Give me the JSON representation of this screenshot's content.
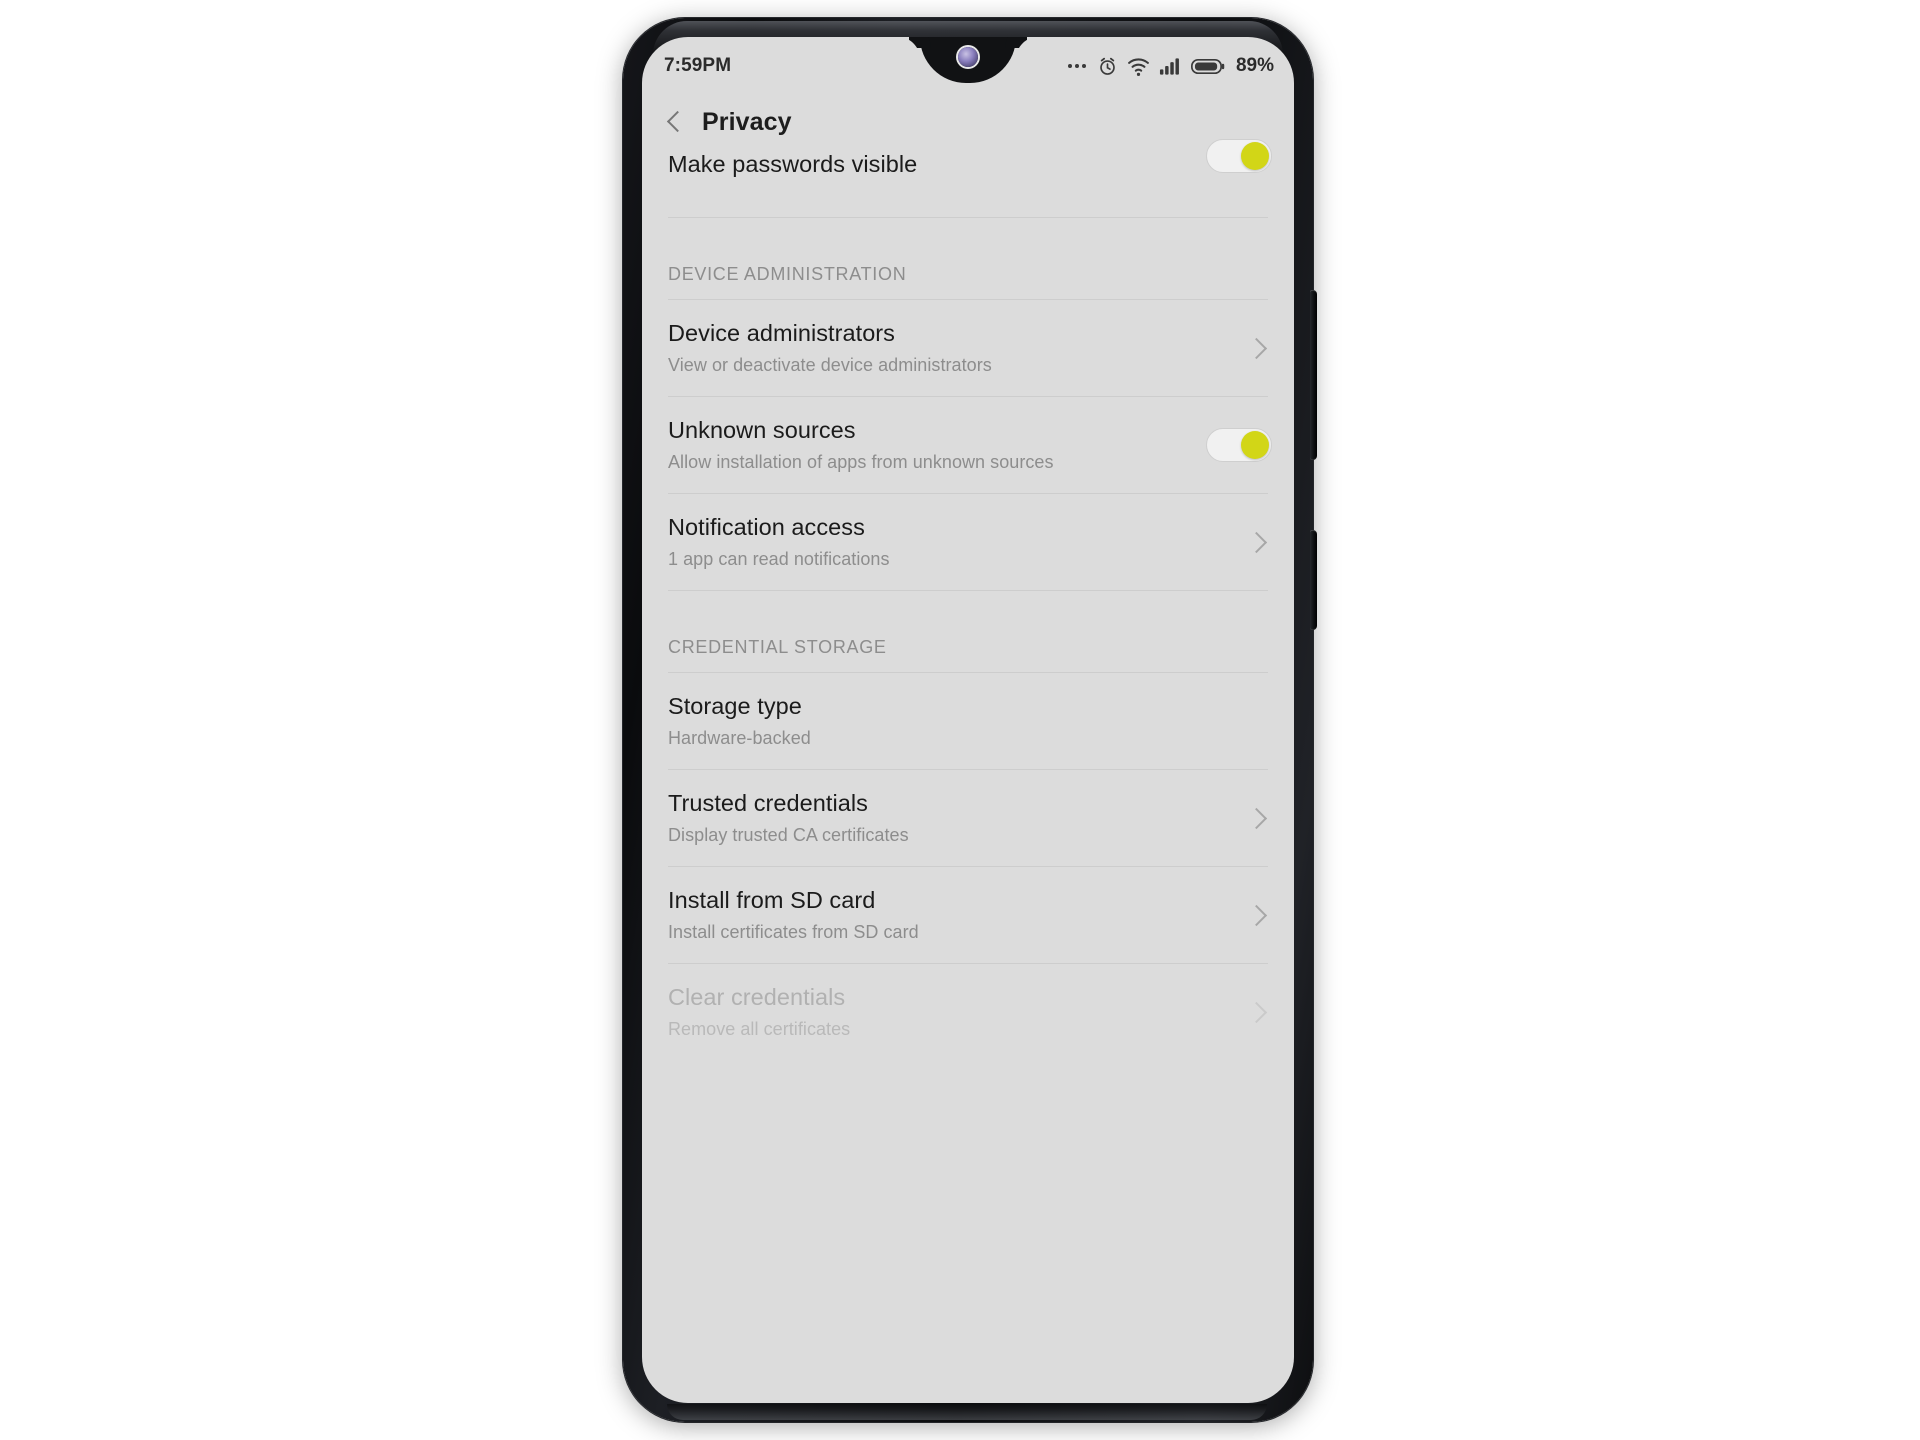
{
  "status_bar": {
    "time": "7:59PM",
    "battery_percent": "89%",
    "icons": [
      "more-dots-icon",
      "alarm-clock-icon",
      "wifi-icon",
      "signal-bars-icon",
      "battery-icon"
    ]
  },
  "app_bar": {
    "back_label": "back-chevron",
    "title": "Privacy"
  },
  "colors": {
    "screen_background": "#dcdcdc",
    "toggle_on_knob": "#d2d617",
    "toggle_track": "#f1f1f1",
    "title_text": "#1b1b1b",
    "subtitle_text": "#8d8d8d",
    "disabled_text": "#b1b1b1",
    "divider": "#cdcdcd"
  },
  "list": {
    "partial_top_row": {
      "title": "Make passwords visible",
      "control": "toggle",
      "toggle_on": true
    },
    "sections": [
      {
        "header": "DEVICE ADMINISTRATION",
        "rows": [
          {
            "title": "Device administrators",
            "subtitle": "View or deactivate device administrators",
            "control": "chevron",
            "disabled": false
          },
          {
            "title": "Unknown sources",
            "subtitle": "Allow installation of apps from unknown sources",
            "control": "toggle",
            "toggle_on": true,
            "disabled": false
          },
          {
            "title": "Notification access",
            "subtitle": "1 app can read notifications",
            "control": "chevron",
            "disabled": false
          }
        ]
      },
      {
        "header": "CREDENTIAL STORAGE",
        "rows": [
          {
            "title": "Storage type",
            "subtitle": "Hardware-backed",
            "control": "none",
            "disabled": false
          },
          {
            "title": "Trusted credentials",
            "subtitle": "Display trusted CA certificates",
            "control": "chevron",
            "disabled": false
          },
          {
            "title": "Install from SD card",
            "subtitle": "Install certificates from SD card",
            "control": "chevron",
            "disabled": false
          },
          {
            "title": "Clear credentials",
            "subtitle": "Remove all certificates",
            "control": "chevron",
            "disabled": true
          }
        ]
      }
    ]
  }
}
